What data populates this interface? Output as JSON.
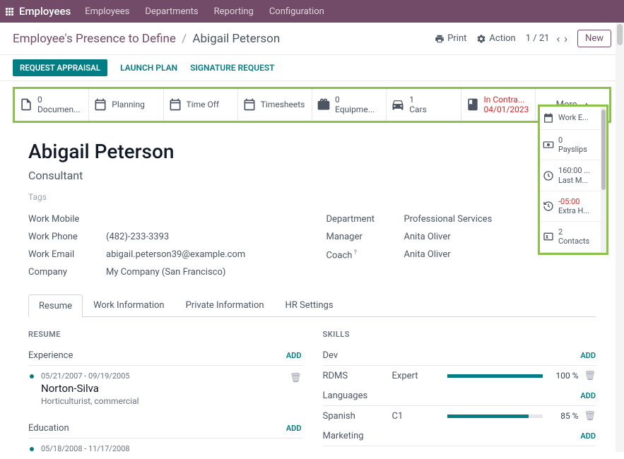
{
  "topbar": {
    "brand": "Employees",
    "nav": [
      "Employees",
      "Departments",
      "Reporting",
      "Configuration"
    ]
  },
  "header": {
    "breadcrumb_root": "Employee's Presence to Define",
    "breadcrumb_current": "Abigail Peterson",
    "print_label": "Print",
    "action_label": "Action",
    "pager": "1 / 21",
    "new_label": "New"
  },
  "actionbar": {
    "primary": "REQUEST APPRAISAL",
    "links": [
      "LAUNCH PLAN",
      "SIGNATURE REQUEST"
    ]
  },
  "stats": {
    "documents": {
      "count": "0",
      "label": "Documen..."
    },
    "planning": {
      "label": "Planning"
    },
    "timeoff": {
      "label": "Time Off"
    },
    "timesheets": {
      "label": "Timesheets"
    },
    "equipment": {
      "count": "0",
      "label": "Equipme..."
    },
    "cars": {
      "count": "1",
      "label": "Cars"
    },
    "contract": {
      "status": "In Contra...",
      "date": "04/01/2023"
    },
    "more": "More"
  },
  "more_panel": {
    "workentries": {
      "label": "Work E..."
    },
    "payslips": {
      "count": "0",
      "label": "Payslips"
    },
    "lastm": {
      "count": "160:00 ...",
      "label": "Last M..."
    },
    "extrah": {
      "count": "-05:00",
      "label": "Extra H..."
    },
    "contacts": {
      "count": "2",
      "label": "Contacts"
    }
  },
  "employee": {
    "name": "Abigail Peterson",
    "job_title": "Consultant",
    "tags_placeholder": "Tags",
    "work_mobile": {
      "label": "Work Mobile",
      "value": ""
    },
    "work_phone": {
      "label": "Work Phone",
      "value": "(482)-233-3393"
    },
    "work_email": {
      "label": "Work Email",
      "value": "abigail.peterson39@example.com"
    },
    "company": {
      "label": "Company",
      "value": "My Company (San Francisco)"
    },
    "department": {
      "label": "Department",
      "value": "Professional Services"
    },
    "manager": {
      "label": "Manager",
      "value": "Anita Oliver"
    },
    "coach": {
      "label": "Coach",
      "value": "Anita Oliver"
    }
  },
  "tabs": [
    "Resume",
    "Work Information",
    "Private Information",
    "HR Settings"
  ],
  "resume": {
    "heading": "RESUME",
    "experience": {
      "label": "Experience",
      "add": "ADD"
    },
    "entry1": {
      "dates": "05/21/2007 - 09/19/2005",
      "title": "Norton-Silva",
      "desc": "Horticulturist, commercial"
    },
    "education": {
      "label": "Education",
      "add": "ADD"
    },
    "entry2": {
      "dates": "05/18/2008 - 11/17/2008",
      "title": ""
    }
  },
  "skills": {
    "heading": "SKILLS",
    "dev": {
      "label": "Dev",
      "add": "ADD"
    },
    "rdms": {
      "name": "RDMS",
      "level": "Expert",
      "pct": "100 %",
      "fill": 100
    },
    "languages": {
      "label": "Languages",
      "add": "ADD"
    },
    "spanish": {
      "name": "Spanish",
      "level": "C1",
      "pct": "85 %",
      "fill": 85
    },
    "marketing": {
      "label": "Marketing",
      "add": "ADD"
    }
  }
}
